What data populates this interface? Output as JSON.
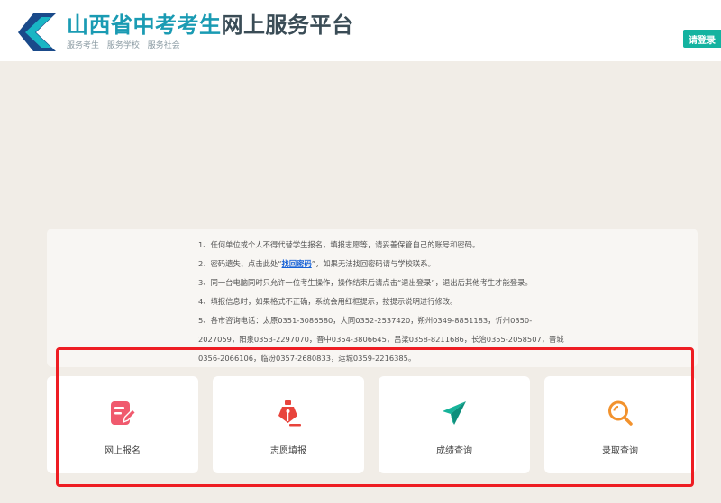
{
  "header": {
    "title_part1": "山西省中考考生",
    "title_part2": "网上服务平台",
    "subtitle": "服务考生 服务学校 服务社会",
    "login_label": "请登录"
  },
  "notice": {
    "item1": "1、任何单位或个人不得代替学生报名，填报志愿等，请妥善保管自己的账号和密码。",
    "item2_pre": "2、密码遗失、点击此处“",
    "item2_link": "找回密码",
    "item2_post": "”，如果无法找回密码请与学校联系。",
    "item3": "3、同一台电脑同时只允许一位考生操作，操作结束后请点击“退出登录”，退出后其他考生才能登录。",
    "item4": "4、填报信息时，如果格式不正确，系统会用红框提示，按提示说明进行修改。",
    "item5_line1": "5、各市咨询电话：太原0351-3086580，大同0352-2537420，朔州0349-8851183，忻州0350-",
    "item5_line2": "2027059，阳泉0353-2297070，晋中0354-3806645，吕梁0358-8211686，长治0355-2058507，晋城",
    "item5_line3": "0356-2066106，临汾0357-2680833，运城0359-2216385。"
  },
  "cards": [
    {
      "label": "网上报名",
      "icon": "edit-icon",
      "color": "#f05a6e"
    },
    {
      "label": "志愿填报",
      "icon": "pen-nib-icon",
      "color": "#e8443c"
    },
    {
      "label": "成绩查询",
      "icon": "paper-plane-icon",
      "color": "#17b39a"
    },
    {
      "label": "录取查询",
      "icon": "search-icon",
      "color": "#f2922d"
    }
  ],
  "colors": {
    "accent": "#1a9bb3",
    "login": "#14b3a0",
    "highlight": "#ee1d23",
    "background": "#f1ede7"
  }
}
